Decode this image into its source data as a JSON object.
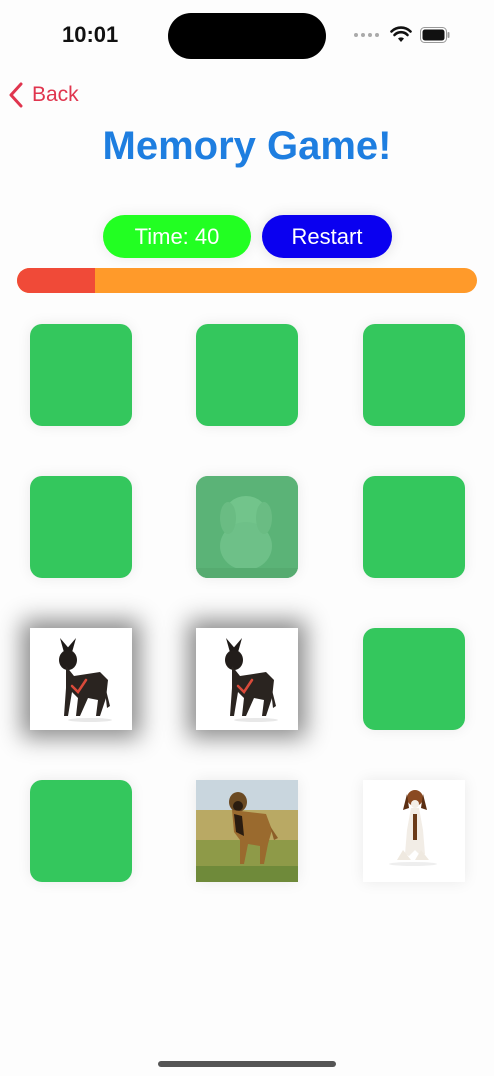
{
  "status": {
    "time": "10:01"
  },
  "nav": {
    "back_label": "Back"
  },
  "title": "Memory Game!",
  "controls": {
    "timer_label": "Time: 40",
    "restart_label": "Restart"
  },
  "progress": {
    "fraction_elapsed": 0.17
  },
  "colors": {
    "card_back": "#34c75d",
    "title": "#1e7ee0",
    "timer": "#22ff22",
    "restart": "#0a00f0",
    "progress_elapsed": "#f04a38",
    "progress_remaining": "#ff9a2a",
    "back": "#e0354e"
  },
  "cards": [
    {
      "state": "hidden"
    },
    {
      "state": "hidden"
    },
    {
      "state": "hidden"
    },
    {
      "state": "hidden"
    },
    {
      "state": "fading",
      "image": "fluffy-white-dog"
    },
    {
      "state": "hidden"
    },
    {
      "state": "matched",
      "image": "dark-brindle-shepherd"
    },
    {
      "state": "matched",
      "image": "dark-brindle-shepherd"
    },
    {
      "state": "hidden"
    },
    {
      "state": "hidden"
    },
    {
      "state": "revealed",
      "image": "brown-dog-field"
    },
    {
      "state": "revealed",
      "image": "foxhound-sitting"
    }
  ]
}
